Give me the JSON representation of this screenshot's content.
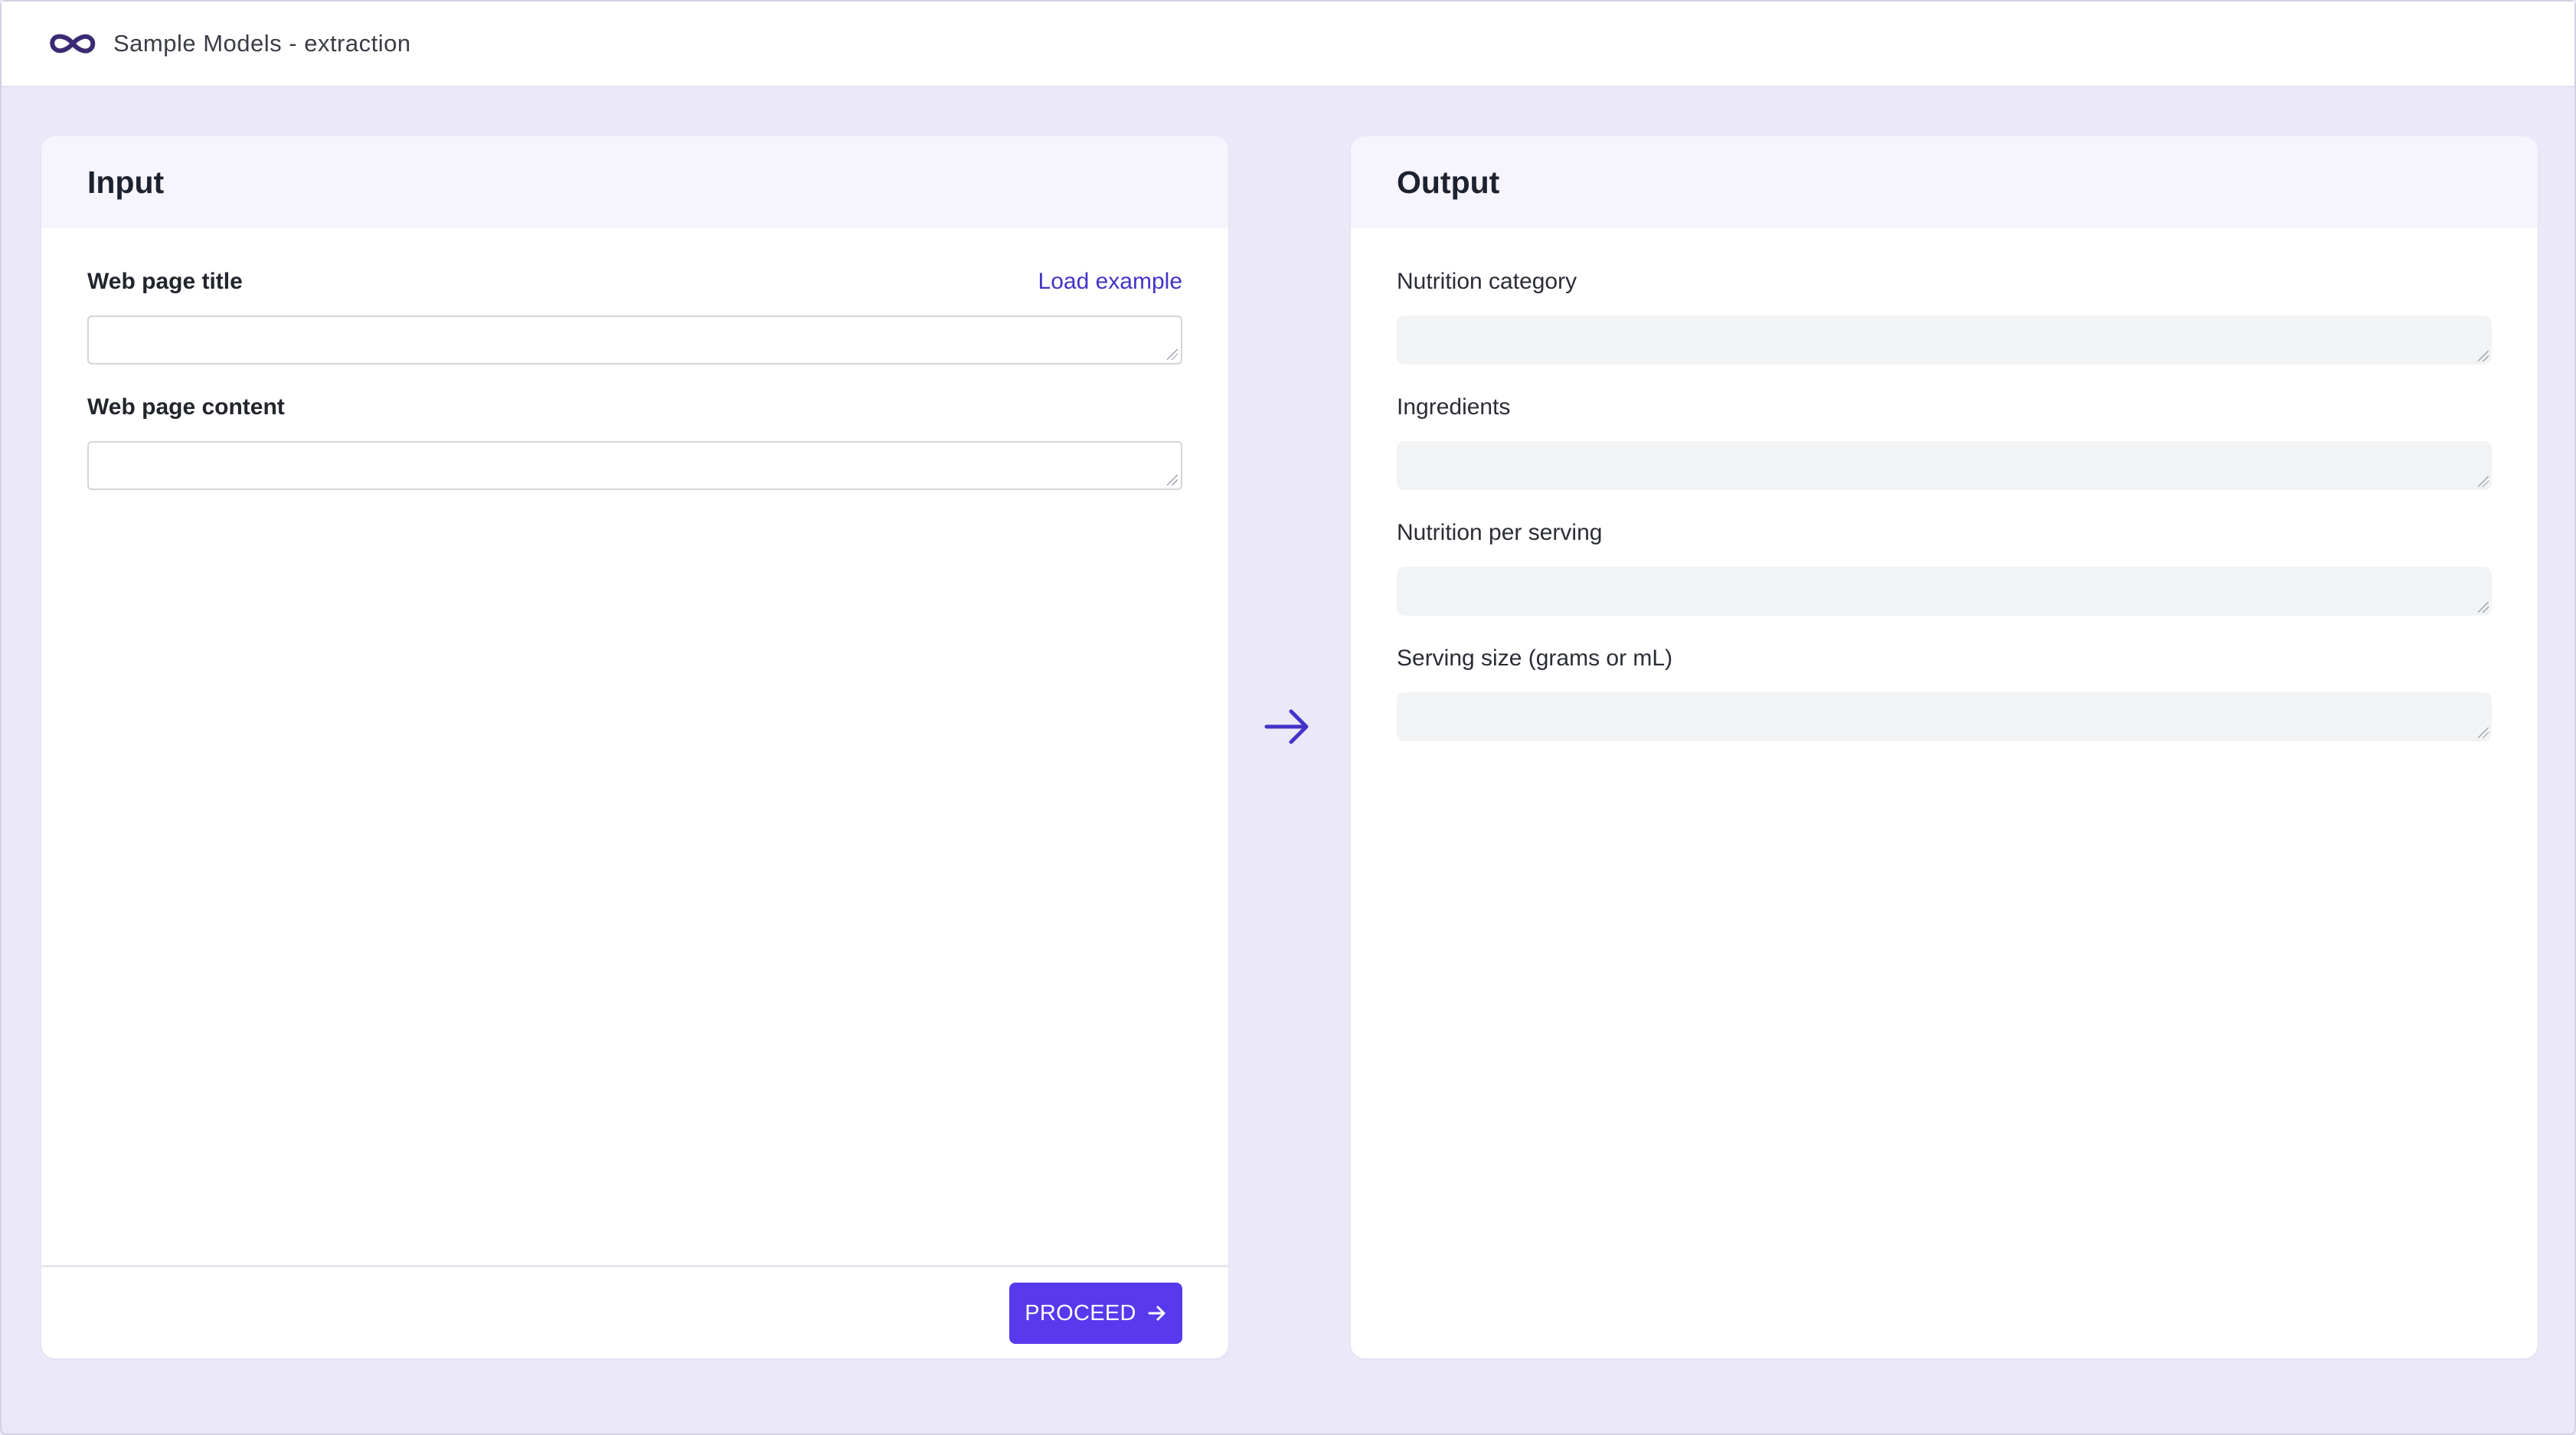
{
  "app": {
    "title": "Sample Models - extraction"
  },
  "input_panel": {
    "title": "Input",
    "load_example_label": "Load example",
    "fields": [
      {
        "label": "Web page title",
        "value": ""
      },
      {
        "label": "Web page content",
        "value": ""
      }
    ],
    "proceed_label": "PROCEED"
  },
  "output_panel": {
    "title": "Output",
    "fields": [
      {
        "label": "Nutrition category",
        "value": ""
      },
      {
        "label": "Ingredients",
        "value": ""
      },
      {
        "label": "Nutrition per serving",
        "value": ""
      },
      {
        "label": "Serving size (grams or mL)",
        "value": ""
      }
    ]
  },
  "icons": {
    "logo": "infinity-logo-icon",
    "proceed": "arrow-right-icon",
    "flow": "arrow-right-icon"
  },
  "colors": {
    "accent": "#5939ee",
    "link": "#4433c8",
    "logo": "#3b2a73",
    "background": "#ebe8f8"
  }
}
